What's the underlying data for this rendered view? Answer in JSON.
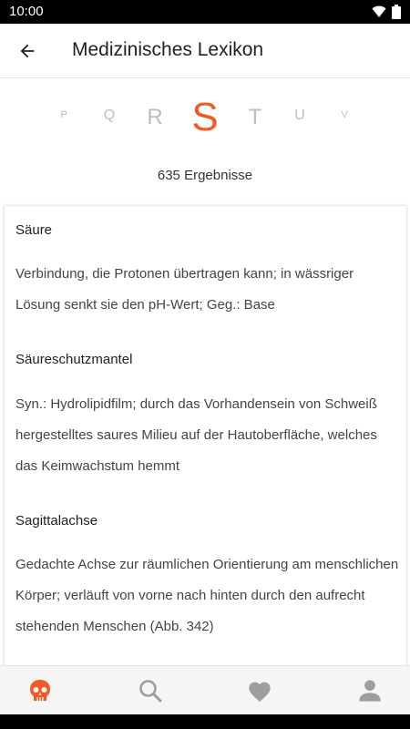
{
  "status_bar": {
    "time": "10:00"
  },
  "app_bar": {
    "title": "Medizinisches Lexikon",
    "back_icon": "arrow-back-icon"
  },
  "letters": [
    {
      "label": "P",
      "active": false
    },
    {
      "label": "Q",
      "active": false
    },
    {
      "label": "R",
      "active": false
    },
    {
      "label": "S",
      "active": true
    },
    {
      "label": "T",
      "active": false
    },
    {
      "label": "U",
      "active": false
    },
    {
      "label": "V",
      "active": false
    }
  ],
  "result_count": "635 Ergebnisse",
  "entries": [
    {
      "term": "Säure",
      "definition": "Verbindung, die Protonen übertragen kann; in wässriger Lösung senkt sie den pH-Wert; Geg.: Base"
    },
    {
      "term": "Säureschutzmantel",
      "definition": "Syn.: Hydrolipidfilm; durch das Vorhandensein von Schweiß hergestelltes saures Milieu auf der Hautoberfläche, welches das Keimwachstum hemmt"
    },
    {
      "term": "Sagittalachse",
      "definition": "Gedachte Achse zur räumlichen Orientierung am menschlichen Körper; verläuft von vorne nach hinten durch den aufrecht stehenden Menschen (Abb. 342)"
    }
  ],
  "bottom_nav": [
    {
      "icon": "skull-icon",
      "active": true
    },
    {
      "icon": "search-icon",
      "active": false
    },
    {
      "icon": "heart-icon",
      "active": false
    },
    {
      "icon": "person-icon",
      "active": false
    }
  ],
  "colors": {
    "accent": "#f15a22",
    "inactive_icon": "#9e9e9e",
    "inactive_letter": "#bdbdbd"
  }
}
